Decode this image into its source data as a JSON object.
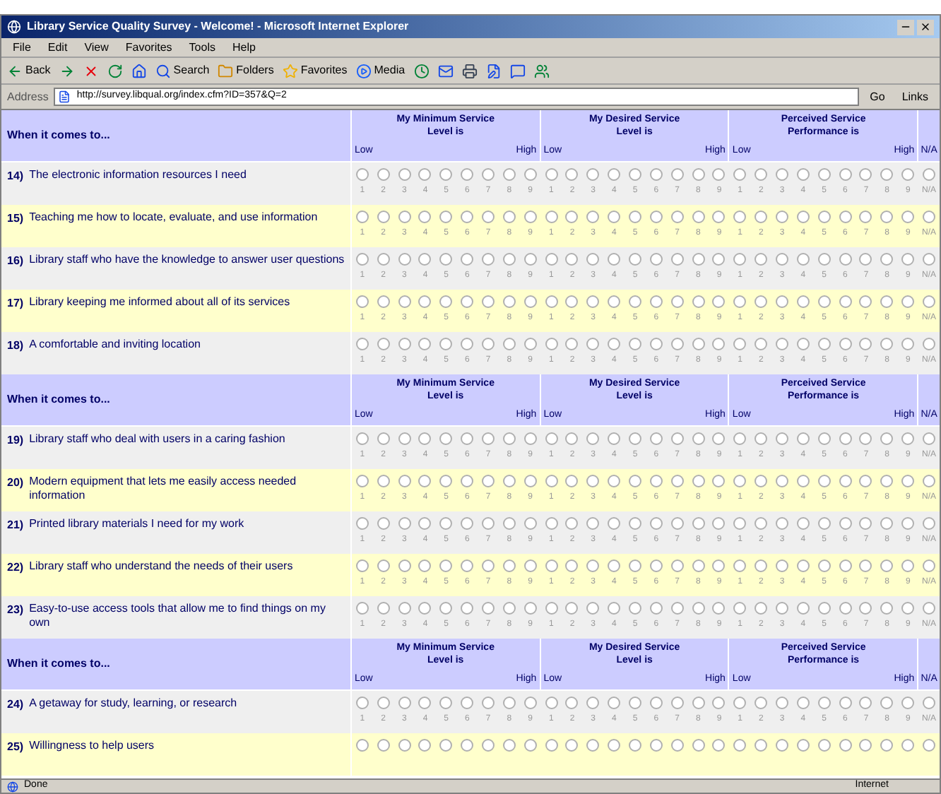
{
  "window": {
    "title": "Library Service Quality Survey - Welcome! - Microsoft Internet Explorer"
  },
  "menu": [
    "File",
    "Edit",
    "View",
    "Favorites",
    "Tools",
    "Help"
  ],
  "toolbar": [
    {
      "kind": "back",
      "label": "Back"
    },
    {
      "kind": "forward"
    },
    {
      "kind": "stop"
    },
    {
      "kind": "refresh"
    },
    {
      "kind": "home"
    },
    {
      "kind": "search",
      "label": "Search"
    },
    {
      "kind": "folders",
      "label": "Folders"
    },
    {
      "kind": "favorites",
      "label": "Favorites"
    },
    {
      "kind": "media",
      "label": "Media"
    },
    {
      "kind": "history"
    },
    {
      "kind": "mail"
    },
    {
      "kind": "print"
    },
    {
      "kind": "edit"
    },
    {
      "kind": "discuss"
    },
    {
      "kind": "messenger"
    }
  ],
  "address": {
    "label": "Address",
    "url": "http://survey.libqual.org/index.cfm?ID=357&Q=2",
    "go": "Go",
    "links": "Links"
  },
  "survey": {
    "sections": [
      {
        "heading": "When it comes to...",
        "scales": [
          {
            "title": "My Minimum Service Level is",
            "low": "Low",
            "high": "High"
          },
          {
            "title": "My Desired Service Level is",
            "low": "Low",
            "high": "High"
          },
          {
            "title": "Perceived Service Performance is",
            "low": "Low",
            "high": "High"
          }
        ],
        "na_label": "N/A",
        "items": [
          {
            "number": "14)",
            "text": "The electronic information resources I need",
            "options": [
              {
                "label": "1",
                "selected": false
              },
              {
                "label": "2",
                "selected": false
              },
              {
                "label": "3",
                "selected": false
              },
              {
                "label": "4",
                "selected": false
              },
              {
                "label": "5",
                "selected": false
              },
              {
                "label": "6",
                "selected": false
              },
              {
                "label": "7",
                "selected": false
              },
              {
                "label": "8",
                "selected": false
              },
              {
                "label": "9",
                "selected": false
              },
              {
                "label": "1",
                "selected": false
              },
              {
                "label": "2",
                "selected": false
              },
              {
                "label": "3",
                "selected": false
              },
              {
                "label": "4",
                "selected": false
              },
              {
                "label": "5",
                "selected": false
              },
              {
                "label": "6",
                "selected": false
              },
              {
                "label": "7",
                "selected": false
              },
              {
                "label": "8",
                "selected": false
              },
              {
                "label": "9",
                "selected": false
              },
              {
                "label": "1",
                "selected": false
              },
              {
                "label": "2",
                "selected": false
              },
              {
                "label": "3",
                "selected": false
              },
              {
                "label": "4",
                "selected": false
              },
              {
                "label": "5",
                "selected": false
              },
              {
                "label": "6",
                "selected": false
              },
              {
                "label": "7",
                "selected": false
              },
              {
                "label": "8",
                "selected": false
              },
              {
                "label": "9",
                "selected": false
              },
              {
                "label": "N/A",
                "selected": false
              }
            ]
          },
          {
            "number": "15)",
            "text": "Teaching me how to locate, evaluate, and use information",
            "options": [
              {
                "label": "1",
                "selected": false
              },
              {
                "label": "2",
                "selected": false
              },
              {
                "label": "3",
                "selected": false
              },
              {
                "label": "4",
                "selected": false
              },
              {
                "label": "5",
                "selected": false
              },
              {
                "label": "6",
                "selected": false
              },
              {
                "label": "7",
                "selected": false
              },
              {
                "label": "8",
                "selected": false
              },
              {
                "label": "9",
                "selected": false
              },
              {
                "label": "1",
                "selected": false
              },
              {
                "label": "2",
                "selected": false
              },
              {
                "label": "3",
                "selected": false
              },
              {
                "label": "4",
                "selected": false
              },
              {
                "label": "5",
                "selected": false
              },
              {
                "label": "6",
                "selected": false
              },
              {
                "label": "7",
                "selected": false
              },
              {
                "label": "8",
                "selected": false
              },
              {
                "label": "9",
                "selected": false
              },
              {
                "label": "1",
                "selected": false
              },
              {
                "label": "2",
                "selected": false
              },
              {
                "label": "3",
                "selected": false
              },
              {
                "label": "4",
                "selected": false
              },
              {
                "label": "5",
                "selected": false
              },
              {
                "label": "6",
                "selected": false
              },
              {
                "label": "7",
                "selected": false
              },
              {
                "label": "8",
                "selected": false
              },
              {
                "label": "9",
                "selected": false
              },
              {
                "label": "N/A",
                "selected": false
              }
            ]
          },
          {
            "number": "16)",
            "text": "Library staff who have the knowledge to answer user questions",
            "options": [
              {
                "label": "1",
                "selected": false
              },
              {
                "label": "2",
                "selected": false
              },
              {
                "label": "3",
                "selected": false
              },
              {
                "label": "4",
                "selected": false
              },
              {
                "label": "5",
                "selected": false
              },
              {
                "label": "6",
                "selected": false
              },
              {
                "label": "7",
                "selected": false
              },
              {
                "label": "8",
                "selected": false
              },
              {
                "label": "9",
                "selected": false
              },
              {
                "label": "1",
                "selected": false
              },
              {
                "label": "2",
                "selected": false
              },
              {
                "label": "3",
                "selected": false
              },
              {
                "label": "4",
                "selected": false
              },
              {
                "label": "5",
                "selected": false
              },
              {
                "label": "6",
                "selected": false
              },
              {
                "label": "7",
                "selected": false
              },
              {
                "label": "8",
                "selected": false
              },
              {
                "label": "9",
                "selected": false
              },
              {
                "label": "1",
                "selected": false
              },
              {
                "label": "2",
                "selected": false
              },
              {
                "label": "3",
                "selected": false
              },
              {
                "label": "4",
                "selected": false
              },
              {
                "label": "5",
                "selected": false
              },
              {
                "label": "6",
                "selected": false
              },
              {
                "label": "7",
                "selected": false
              },
              {
                "label": "8",
                "selected": false
              },
              {
                "label": "9",
                "selected": false
              },
              {
                "label": "N/A",
                "selected": false
              }
            ]
          },
          {
            "number": "17)",
            "text": "Library keeping me informed about all of its services",
            "options": [
              {
                "label": "1",
                "selected": false
              },
              {
                "label": "2",
                "selected": false
              },
              {
                "label": "3",
                "selected": false
              },
              {
                "label": "4",
                "selected": false
              },
              {
                "label": "5",
                "selected": false
              },
              {
                "label": "6",
                "selected": false
              },
              {
                "label": "7",
                "selected": false
              },
              {
                "label": "8",
                "selected": false
              },
              {
                "label": "9",
                "selected": false
              },
              {
                "label": "1",
                "selected": false
              },
              {
                "label": "2",
                "selected": false
              },
              {
                "label": "3",
                "selected": false
              },
              {
                "label": "4",
                "selected": false
              },
              {
                "label": "5",
                "selected": false
              },
              {
                "label": "6",
                "selected": false
              },
              {
                "label": "7",
                "selected": false
              },
              {
                "label": "8",
                "selected": false
              },
              {
                "label": "9",
                "selected": false
              },
              {
                "label": "1",
                "selected": false
              },
              {
                "label": "2",
                "selected": false
              },
              {
                "label": "3",
                "selected": false
              },
              {
                "label": "4",
                "selected": false
              },
              {
                "label": "5",
                "selected": false
              },
              {
                "label": "6",
                "selected": false
              },
              {
                "label": "7",
                "selected": false
              },
              {
                "label": "8",
                "selected": false
              },
              {
                "label": "9",
                "selected": false
              },
              {
                "label": "N/A",
                "selected": false
              }
            ]
          },
          {
            "number": "18)",
            "text": "A comfortable and inviting location",
            "options": [
              {
                "label": "1",
                "selected": false
              },
              {
                "label": "2",
                "selected": false
              },
              {
                "label": "3",
                "selected": false
              },
              {
                "label": "4",
                "selected": false
              },
              {
                "label": "5",
                "selected": false
              },
              {
                "label": "6",
                "selected": false
              },
              {
                "label": "7",
                "selected": false
              },
              {
                "label": "8",
                "selected": false
              },
              {
                "label": "9",
                "selected": false
              },
              {
                "label": "1",
                "selected": false
              },
              {
                "label": "2",
                "selected": false
              },
              {
                "label": "3",
                "selected": false
              },
              {
                "label": "4",
                "selected": false
              },
              {
                "label": "5",
                "selected": false
              },
              {
                "label": "6",
                "selected": false
              },
              {
                "label": "7",
                "selected": false
              },
              {
                "label": "8",
                "selected": false
              },
              {
                "label": "9",
                "selected": false
              },
              {
                "label": "1",
                "selected": false
              },
              {
                "label": "2",
                "selected": false
              },
              {
                "label": "3",
                "selected": false
              },
              {
                "label": "4",
                "selected": false
              },
              {
                "label": "5",
                "selected": false
              },
              {
                "label": "6",
                "selected": false
              },
              {
                "label": "7",
                "selected": false
              },
              {
                "label": "8",
                "selected": false
              },
              {
                "label": "9",
                "selected": false
              },
              {
                "label": "N/A",
                "selected": false
              }
            ]
          }
        ]
      },
      {
        "heading": "When it comes to...",
        "scales": [
          {
            "title": "My Minimum Service Level is",
            "low": "Low",
            "high": "High"
          },
          {
            "title": "My Desired Service Level is",
            "low": "Low",
            "high": "High"
          },
          {
            "title": "Perceived Service Performance is",
            "low": "Low",
            "high": "High"
          }
        ],
        "na_label": "N/A",
        "items": [
          {
            "number": "19)",
            "text": "Library staff who deal with users in a caring fashion",
            "options": [
              {
                "label": "1",
                "selected": false
              },
              {
                "label": "2",
                "selected": false
              },
              {
                "label": "3",
                "selected": false
              },
              {
                "label": "4",
                "selected": false
              },
              {
                "label": "5",
                "selected": false
              },
              {
                "label": "6",
                "selected": false
              },
              {
                "label": "7",
                "selected": false
              },
              {
                "label": "8",
                "selected": false
              },
              {
                "label": "9",
                "selected": false
              },
              {
                "label": "1",
                "selected": false
              },
              {
                "label": "2",
                "selected": false
              },
              {
                "label": "3",
                "selected": false
              },
              {
                "label": "4",
                "selected": false
              },
              {
                "label": "5",
                "selected": false
              },
              {
                "label": "6",
                "selected": false
              },
              {
                "label": "7",
                "selected": false
              },
              {
                "label": "8",
                "selected": false
              },
              {
                "label": "9",
                "selected": false
              },
              {
                "label": "1",
                "selected": false
              },
              {
                "label": "2",
                "selected": false
              },
              {
                "label": "3",
                "selected": false
              },
              {
                "label": "4",
                "selected": false
              },
              {
                "label": "5",
                "selected": false
              },
              {
                "label": "6",
                "selected": false
              },
              {
                "label": "7",
                "selected": false
              },
              {
                "label": "8",
                "selected": false
              },
              {
                "label": "9",
                "selected": false
              },
              {
                "label": "N/A",
                "selected": false
              }
            ]
          },
          {
            "number": "20)",
            "text": "Modern equipment that lets me easily access needed information",
            "options": [
              {
                "label": "1",
                "selected": false
              },
              {
                "label": "2",
                "selected": false
              },
              {
                "label": "3",
                "selected": false
              },
              {
                "label": "4",
                "selected": false
              },
              {
                "label": "5",
                "selected": false
              },
              {
                "label": "6",
                "selected": false
              },
              {
                "label": "7",
                "selected": false
              },
              {
                "label": "8",
                "selected": false
              },
              {
                "label": "9",
                "selected": false
              },
              {
                "label": "1",
                "selected": false
              },
              {
                "label": "2",
                "selected": false
              },
              {
                "label": "3",
                "selected": false
              },
              {
                "label": "4",
                "selected": false
              },
              {
                "label": "5",
                "selected": false
              },
              {
                "label": "6",
                "selected": false
              },
              {
                "label": "7",
                "selected": false
              },
              {
                "label": "8",
                "selected": false
              },
              {
                "label": "9",
                "selected": false
              },
              {
                "label": "1",
                "selected": false
              },
              {
                "label": "2",
                "selected": false
              },
              {
                "label": "3",
                "selected": false
              },
              {
                "label": "4",
                "selected": false
              },
              {
                "label": "5",
                "selected": false
              },
              {
                "label": "6",
                "selected": false
              },
              {
                "label": "7",
                "selected": false
              },
              {
                "label": "8",
                "selected": false
              },
              {
                "label": "9",
                "selected": false
              },
              {
                "label": "N/A",
                "selected": false
              }
            ]
          },
          {
            "number": "21)",
            "text": "Printed library materials I need for my work",
            "options": [
              {
                "label": "1",
                "selected": false
              },
              {
                "label": "2",
                "selected": false
              },
              {
                "label": "3",
                "selected": false
              },
              {
                "label": "4",
                "selected": false
              },
              {
                "label": "5",
                "selected": false
              },
              {
                "label": "6",
                "selected": false
              },
              {
                "label": "7",
                "selected": false
              },
              {
                "label": "8",
                "selected": false
              },
              {
                "label": "9",
                "selected": false
              },
              {
                "label": "1",
                "selected": false
              },
              {
                "label": "2",
                "selected": false
              },
              {
                "label": "3",
                "selected": false
              },
              {
                "label": "4",
                "selected": false
              },
              {
                "label": "5",
                "selected": false
              },
              {
                "label": "6",
                "selected": false
              },
              {
                "label": "7",
                "selected": false
              },
              {
                "label": "8",
                "selected": false
              },
              {
                "label": "9",
                "selected": false
              },
              {
                "label": "1",
                "selected": false
              },
              {
                "label": "2",
                "selected": false
              },
              {
                "label": "3",
                "selected": false
              },
              {
                "label": "4",
                "selected": false
              },
              {
                "label": "5",
                "selected": false
              },
              {
                "label": "6",
                "selected": false
              },
              {
                "label": "7",
                "selected": false
              },
              {
                "label": "8",
                "selected": false
              },
              {
                "label": "9",
                "selected": false
              },
              {
                "label": "N/A",
                "selected": false
              }
            ]
          },
          {
            "number": "22)",
            "text": "Library staff who understand the needs of their users",
            "options": [
              {
                "label": "1",
                "selected": false
              },
              {
                "label": "2",
                "selected": false
              },
              {
                "label": "3",
                "selected": false
              },
              {
                "label": "4",
                "selected": false
              },
              {
                "label": "5",
                "selected": false
              },
              {
                "label": "6",
                "selected": false
              },
              {
                "label": "7",
                "selected": false
              },
              {
                "label": "8",
                "selected": false
              },
              {
                "label": "9",
                "selected": false
              },
              {
                "label": "1",
                "selected": false
              },
              {
                "label": "2",
                "selected": false
              },
              {
                "label": "3",
                "selected": false
              },
              {
                "label": "4",
                "selected": false
              },
              {
                "label": "5",
                "selected": false
              },
              {
                "label": "6",
                "selected": false
              },
              {
                "label": "7",
                "selected": false
              },
              {
                "label": "8",
                "selected": false
              },
              {
                "label": "9",
                "selected": false
              },
              {
                "label": "1",
                "selected": false
              },
              {
                "label": "2",
                "selected": false
              },
              {
                "label": "3",
                "selected": false
              },
              {
                "label": "4",
                "selected": false
              },
              {
                "label": "5",
                "selected": false
              },
              {
                "label": "6",
                "selected": false
              },
              {
                "label": "7",
                "selected": false
              },
              {
                "label": "8",
                "selected": false
              },
              {
                "label": "9",
                "selected": false
              },
              {
                "label": "N/A",
                "selected": false
              }
            ]
          },
          {
            "number": "23)",
            "text": "Easy-to-use access tools that allow me to find things on my own",
            "options": [
              {
                "label": "1",
                "selected": false
              },
              {
                "label": "2",
                "selected": false
              },
              {
                "label": "3",
                "selected": false
              },
              {
                "label": "4",
                "selected": false
              },
              {
                "label": "5",
                "selected": false
              },
              {
                "label": "6",
                "selected": false
              },
              {
                "label": "7",
                "selected": false
              },
              {
                "label": "8",
                "selected": false
              },
              {
                "label": "9",
                "selected": false
              },
              {
                "label": "1",
                "selected": false
              },
              {
                "label": "2",
                "selected": false
              },
              {
                "label": "3",
                "selected": false
              },
              {
                "label": "4",
                "selected": false
              },
              {
                "label": "5",
                "selected": false
              },
              {
                "label": "6",
                "selected": false
              },
              {
                "label": "7",
                "selected": false
              },
              {
                "label": "8",
                "selected": false
              },
              {
                "label": "9",
                "selected": false
              },
              {
                "label": "1",
                "selected": false
              },
              {
                "label": "2",
                "selected": false
              },
              {
                "label": "3",
                "selected": false
              },
              {
                "label": "4",
                "selected": false
              },
              {
                "label": "5",
                "selected": false
              },
              {
                "label": "6",
                "selected": false
              },
              {
                "label": "7",
                "selected": false
              },
              {
                "label": "8",
                "selected": false
              },
              {
                "label": "9",
                "selected": false
              },
              {
                "label": "N/A",
                "selected": false
              }
            ]
          }
        ]
      },
      {
        "heading": "When it comes to...",
        "scales": [
          {
            "title": "My Minimum Service Level is",
            "low": "Low",
            "high": "High"
          },
          {
            "title": "My Desired Service Level is",
            "low": "Low",
            "high": "High"
          },
          {
            "title": "Perceived Service Performance is",
            "low": "Low",
            "high": "High"
          }
        ],
        "na_label": "N/A",
        "items": [
          {
            "number": "24)",
            "text": "A getaway for study, learning, or research",
            "options": [
              {
                "label": "1",
                "selected": false
              },
              {
                "label": "2",
                "selected": false
              },
              {
                "label": "3",
                "selected": false
              },
              {
                "label": "4",
                "selected": false
              },
              {
                "label": "5",
                "selected": false
              },
              {
                "label": "6",
                "selected": false
              },
              {
                "label": "7",
                "selected": false
              },
              {
                "label": "8",
                "selected": false
              },
              {
                "label": "9",
                "selected": false
              },
              {
                "label": "1",
                "selected": false
              },
              {
                "label": "2",
                "selected": false
              },
              {
                "label": "3",
                "selected": false
              },
              {
                "label": "4",
                "selected": false
              },
              {
                "label": "5",
                "selected": false
              },
              {
                "label": "6",
                "selected": false
              },
              {
                "label": "7",
                "selected": false
              },
              {
                "label": "8",
                "selected": false
              },
              {
                "label": "9",
                "selected": false
              },
              {
                "label": "1",
                "selected": false
              },
              {
                "label": "2",
                "selected": false
              },
              {
                "label": "3",
                "selected": false
              },
              {
                "label": "4",
                "selected": false
              },
              {
                "label": "5",
                "selected": false
              },
              {
                "label": "6",
                "selected": false
              },
              {
                "label": "7",
                "selected": false
              },
              {
                "label": "8",
                "selected": false
              },
              {
                "label": "9",
                "selected": false
              },
              {
                "label": "N/A",
                "selected": false
              }
            ]
          },
          {
            "number": "25)",
            "text": "Willingness to help users",
            "options": [
              {
                "selected": false
              },
              {
                "selected": false
              },
              {
                "selected": false
              },
              {
                "selected": false
              },
              {
                "selected": false
              },
              {
                "selected": false
              },
              {
                "selected": false
              },
              {
                "selected": false
              },
              {
                "selected": false
              },
              {
                "selected": false
              },
              {
                "selected": false
              },
              {
                "selected": false
              },
              {
                "selected": false
              },
              {
                "selected": false
              },
              {
                "selected": false
              },
              {
                "selected": false
              },
              {
                "selected": false
              },
              {
                "selected": false
              },
              {
                "selected": false
              },
              {
                "selected": false
              },
              {
                "selected": false
              },
              {
                "selected": false
              },
              {
                "selected": false
              },
              {
                "selected": false
              },
              {
                "selected": false
              },
              {
                "selected": false
              },
              {
                "selected": false
              },
              {
                "selected": false
              }
            ]
          }
        ]
      }
    ]
  },
  "status_bar": {
    "text": "Done",
    "zone": "Internet"
  }
}
